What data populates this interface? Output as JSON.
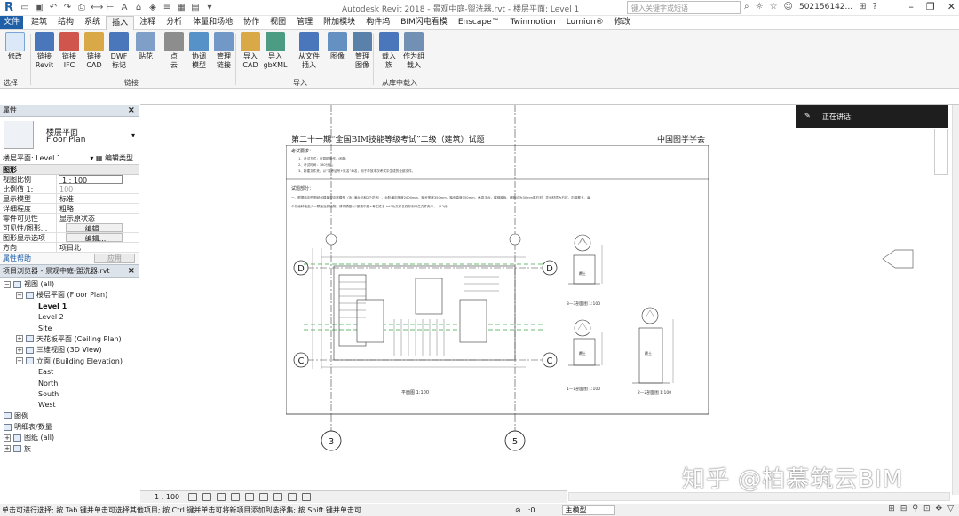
{
  "titlebar": {
    "logo": "R",
    "title": "Autodesk Revit 2018 -   景观中庭-盥洗器.rvt - 楼层平面: Level 1",
    "search_placeholder": "键入关键字或短语",
    "user": "502156142...",
    "icons": [
      "binoculars-icon",
      "star-icon",
      "user-icon",
      "cart-icon",
      "help-icon",
      "minimize-icon",
      "restore-icon",
      "close-icon"
    ]
  },
  "tabs": [
    "文件",
    "建筑",
    "结构",
    "系统",
    "插入",
    "注释",
    "分析",
    "体量和场地",
    "协作",
    "视图",
    "管理",
    "附加模块",
    "构件坞",
    "BIM闪电看模",
    "Enscape™",
    "Twinmotion",
    "Lumion®",
    "修改"
  ],
  "active_tab": "插入",
  "ribbon": {
    "modify": "修改",
    "select_label": "选择",
    "link_group_label": "链接",
    "import_group_label": "导入",
    "library_group_label": "从库中载入",
    "buttons": [
      {
        "l1": "链接",
        "l2": "Revit"
      },
      {
        "l1": "链接",
        "l2": "IFC"
      },
      {
        "l1": "链接",
        "l2": "CAD"
      },
      {
        "l1": "DWF",
        "l2": "标记"
      },
      {
        "l1": "贴花",
        "l2": ""
      },
      {
        "l1": "点",
        "l2": "云"
      },
      {
        "l1": "协调",
        "l2": "模型"
      },
      {
        "l1": "管理",
        "l2": "链接"
      },
      {
        "l1": "导入",
        "l2": "CAD"
      },
      {
        "l1": "导入",
        "l2": "gbXML"
      },
      {
        "l1": "从文件",
        "l2": "插入"
      },
      {
        "l1": "图像",
        "l2": ""
      },
      {
        "l1": "管理",
        "l2": "图像"
      },
      {
        "l1": "载入",
        "l2": "族"
      },
      {
        "l1": "作为组",
        "l2": "载入"
      }
    ]
  },
  "properties": {
    "header": "属性",
    "type_name1": "楼层平面",
    "type_name2": "Floor Plan",
    "instance": "楼层平面: Level 1",
    "edit_type": "编辑类型",
    "section": "图形",
    "rows": [
      {
        "k": "视图比例",
        "v": "1 : 100"
      },
      {
        "k": "比例值 1:",
        "v": "100"
      },
      {
        "k": "显示模型",
        "v": "标准"
      },
      {
        "k": "详细程度",
        "v": "粗略"
      },
      {
        "k": "零件可见性",
        "v": "显示原状态"
      },
      {
        "k": "可见性/图形...",
        "v": "编辑..."
      },
      {
        "k": "图形显示选项",
        "v": "编辑..."
      },
      {
        "k": "方向",
        "v": "项目北"
      }
    ],
    "help": "属性帮助",
    "apply": "应用"
  },
  "browser": {
    "header": "项目浏览器 - 景观中庭-盥洗器.rvt",
    "nodes": [
      {
        "t": "视图 (all)",
        "lvl": 0,
        "exp": "−"
      },
      {
        "t": "楼层平面 (Floor Plan)",
        "lvl": 1,
        "exp": "−"
      },
      {
        "t": "Level 1",
        "lvl": 2,
        "exp": "",
        "bold": true
      },
      {
        "t": "Level 2",
        "lvl": 2,
        "exp": ""
      },
      {
        "t": "Site",
        "lvl": 2,
        "exp": ""
      },
      {
        "t": "天花板平面 (Ceiling Plan)",
        "lvl": 1,
        "exp": "+"
      },
      {
        "t": "三维视图 (3D View)",
        "lvl": 1,
        "exp": "+"
      },
      {
        "t": "立面 (Building Elevation)",
        "lvl": 1,
        "exp": "−"
      },
      {
        "t": "East",
        "lvl": 2,
        "exp": ""
      },
      {
        "t": "North",
        "lvl": 2,
        "exp": ""
      },
      {
        "t": "South",
        "lvl": 2,
        "exp": ""
      },
      {
        "t": "West",
        "lvl": 2,
        "exp": ""
      },
      {
        "t": "图例",
        "lvl": 0,
        "exp": "",
        "icon": true
      },
      {
        "t": "明细表/数量",
        "lvl": 0,
        "exp": "",
        "icon": true
      },
      {
        "t": "图纸 (all)",
        "lvl": 0,
        "exp": "+",
        "icon": true
      },
      {
        "t": "族",
        "lvl": 0,
        "exp": "+",
        "icon": true
      }
    ]
  },
  "drawing": {
    "sheet_title": "第二十一期“全国BIM技能等级考试”二级（建筑）试题",
    "org": "中国图学学会",
    "req_title": "考试要求：",
    "req_lines": [
      "1、考试方式：计算机操作，闭卷；",
      "2、考试时间：180分钟；",
      "3、新建文件夹，以“准考证号+姓名”命名，用于存放本次考试中生成的全部文件。"
    ],
    "sub_title": "试题部分：",
    "sub_line1": "一、根据给定的图纸创建景观中庭模型（含1道台阶和2个花池），台阶横向宽度2000mm，踏步宽度350mm，踏步高度150mm，休息平台，楼梯踏板、踢板均为30mm厚石材，花池材质为石材，内填覆土。每",
    "sub_line2": "个花池种植至少一颗适当的植物。请将模型以“景观中庭+考生姓名.rvt”为文件名保存到考生文件夹中。（12分）",
    "grid_d": "D",
    "grid_c": "C",
    "grid_3": "3",
    "grid_5": "5",
    "plan_title": "平面图 1:100",
    "sec33": "3—3剖面图 1:100",
    "sec11": "1—1剖面图 1:100",
    "sec22": "2—2剖面图 1:100",
    "side1": "第",
    "side2": "1",
    "side3": "页",
    "side4": "共",
    "side5": "14",
    "side6": "页",
    "tree_label": "覆土"
  },
  "speaking": "正在讲话:",
  "viewctrl": {
    "scale": "1 : 100"
  },
  "status": {
    "message": "单击可进行选择; 按 Tab 键并单击可选择其他项目; 按 Ctrl 键并单击可将新项目添加到选择集; 按 Shift 键并单击可",
    "count": ":0",
    "model": "主模型"
  },
  "watermark": "知乎 @柏慕筑云BIM"
}
